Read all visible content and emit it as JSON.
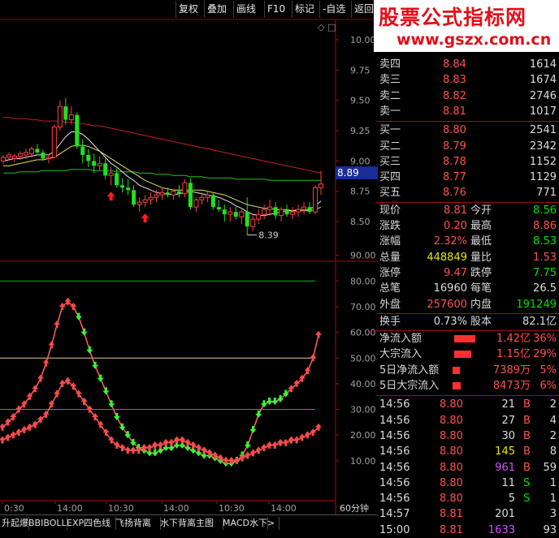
{
  "toolbar": {
    "buttons": [
      {
        "name": "fuquan-button",
        "label": "复权"
      },
      {
        "name": "diejia-button",
        "label": "叠加"
      },
      {
        "name": "huaxian-button",
        "label": "画线"
      },
      {
        "name": "f10-button",
        "label": "F10"
      },
      {
        "name": "biaoji-button",
        "label": "标记"
      },
      {
        "name": "zixuan-button",
        "label": "-自选"
      },
      {
        "name": "fanhui-button",
        "label": "返回"
      }
    ]
  },
  "watermark": {
    "title": "股票公式指标网",
    "url": "www.gszx.com.cn"
  },
  "price_axis": {
    "ticks": [
      "10.00",
      "9.75",
      "9.50",
      "9.25",
      "9.00",
      "8.75",
      "8.50"
    ],
    "current": "8.89"
  },
  "indicator_axis": {
    "ticks": [
      "90.00",
      "80.00",
      "70.00",
      "60.00",
      "50.00",
      "40.00",
      "30.00",
      "20.00",
      "10.00"
    ]
  },
  "time_axis": {
    "labels": [
      "0:30",
      "14:00",
      "10:30",
      "14:00",
      "10:30",
      "14:00"
    ],
    "period": "60分钟"
  },
  "chart_annotations": {
    "low_label": "8.39"
  },
  "chart_data": [
    {
      "type": "candlestick",
      "title": "",
      "ylim": [
        8.32,
        10.1
      ],
      "candles": [
        [
          9.0,
          9.05,
          8.98,
          9.03
        ],
        [
          9.03,
          9.07,
          9.0,
          9.05
        ],
        [
          9.02,
          9.06,
          8.99,
          9.04
        ],
        [
          9.04,
          9.08,
          9.01,
          9.06
        ],
        [
          9.05,
          9.1,
          9.02,
          9.07
        ],
        [
          9.06,
          9.12,
          9.03,
          9.1
        ],
        [
          9.1,
          9.14,
          9.06,
          9.07
        ],
        [
          9.07,
          9.09,
          9.0,
          9.02
        ],
        [
          9.02,
          9.06,
          8.98,
          9.03
        ],
        [
          9.03,
          9.3,
          9.02,
          9.28
        ],
        [
          9.28,
          9.5,
          9.25,
          9.45
        ],
        [
          9.45,
          9.52,
          9.3,
          9.34
        ],
        [
          9.34,
          9.45,
          9.3,
          9.38
        ],
        [
          9.38,
          9.4,
          9.1,
          9.12
        ],
        [
          9.12,
          9.18,
          8.98,
          9.05
        ],
        [
          9.05,
          9.1,
          8.95,
          9.0
        ],
        [
          9.0,
          9.06,
          8.9,
          8.96
        ],
        [
          8.96,
          9.04,
          8.92,
          8.98
        ],
        [
          8.98,
          9.02,
          8.85,
          8.88
        ],
        [
          8.88,
          8.95,
          8.8,
          8.9
        ],
        [
          8.9,
          8.94,
          8.78,
          8.8
        ],
        [
          8.8,
          8.86,
          8.74,
          8.78
        ],
        [
          8.78,
          8.85,
          8.72,
          8.76
        ],
        [
          8.76,
          8.8,
          8.62,
          8.64
        ],
        [
          8.64,
          8.7,
          8.58,
          8.66
        ],
        [
          8.66,
          8.72,
          8.62,
          8.68
        ],
        [
          8.68,
          8.74,
          8.64,
          8.7
        ],
        [
          8.7,
          8.76,
          8.66,
          8.72
        ],
        [
          8.72,
          8.78,
          8.68,
          8.74
        ],
        [
          8.74,
          8.78,
          8.7,
          8.72
        ],
        [
          8.72,
          8.77,
          8.68,
          8.75
        ],
        [
          8.75,
          8.8,
          8.7,
          8.73
        ],
        [
          8.73,
          8.85,
          8.7,
          8.82
        ],
        [
          8.82,
          8.86,
          8.6,
          8.62
        ],
        [
          8.62,
          8.7,
          8.58,
          8.68
        ],
        [
          8.68,
          8.74,
          8.64,
          8.7
        ],
        [
          8.7,
          8.75,
          8.66,
          8.72
        ],
        [
          8.72,
          8.74,
          8.6,
          8.62
        ],
        [
          8.62,
          8.68,
          8.58,
          8.6
        ],
        [
          8.6,
          8.64,
          8.5,
          8.56
        ],
        [
          8.56,
          8.62,
          8.5,
          8.58
        ],
        [
          8.58,
          8.62,
          8.52,
          8.54
        ],
        [
          8.54,
          8.6,
          8.48,
          8.58
        ],
        [
          8.58,
          8.7,
          8.39,
          8.46
        ],
        [
          8.46,
          8.56,
          8.42,
          8.52
        ],
        [
          8.52,
          8.6,
          8.48,
          8.56
        ],
        [
          8.56,
          8.64,
          8.52,
          8.6
        ],
        [
          8.6,
          8.68,
          8.55,
          8.62
        ],
        [
          8.62,
          8.66,
          8.52,
          8.55
        ],
        [
          8.55,
          8.62,
          8.5,
          8.6
        ],
        [
          8.6,
          8.64,
          8.54,
          8.56
        ],
        [
          8.56,
          8.62,
          8.52,
          8.58
        ],
        [
          8.58,
          8.64,
          8.54,
          8.6
        ],
        [
          8.6,
          8.66,
          8.56,
          8.62
        ],
        [
          8.62,
          8.66,
          8.56,
          8.58
        ],
        [
          8.58,
          8.8,
          8.56,
          8.78
        ],
        [
          8.78,
          8.92,
          8.72,
          8.81
        ]
      ],
      "series": [
        {
          "values": [
            9.36,
            9.36,
            9.35,
            9.35,
            9.35,
            9.34,
            9.34,
            9.33,
            9.33,
            9.33,
            9.33,
            9.32,
            9.32,
            9.31,
            9.31,
            9.3,
            9.29,
            9.29,
            9.28,
            9.27,
            9.26,
            9.25,
            9.24,
            9.23,
            9.22,
            9.21,
            9.2,
            9.19,
            9.18,
            9.17,
            9.16,
            9.15,
            9.14,
            9.13,
            9.12,
            9.11,
            9.1,
            9.09,
            9.08,
            9.07,
            9.06,
            9.05,
            9.04,
            9.03,
            9.02,
            9.01,
            9.0,
            8.99,
            8.98,
            8.97,
            8.96,
            8.95,
            8.94,
            8.93,
            8.92,
            8.91,
            8.9
          ],
          "color": "#c02020"
        },
        {
          "values": [
            8.9,
            8.9,
            8.9,
            8.91,
            8.91,
            8.91,
            8.91,
            8.92,
            8.92,
            8.92,
            8.92,
            8.92,
            8.93,
            8.93,
            8.93,
            8.93,
            8.92,
            8.92,
            8.92,
            8.92,
            8.91,
            8.91,
            8.91,
            8.91,
            8.9,
            8.9,
            8.9,
            8.89,
            8.89,
            8.89,
            8.88,
            8.88,
            8.88,
            8.87,
            8.87,
            8.87,
            8.86,
            8.86,
            8.86,
            8.86,
            8.86,
            8.85,
            8.85,
            8.85,
            8.85,
            8.85,
            8.85,
            8.84,
            8.84,
            8.84,
            8.84,
            8.84,
            8.84,
            8.84,
            8.84,
            8.84,
            8.84
          ],
          "color": "#20c020"
        },
        {
          "values": [
            9.0,
            9.01,
            9.02,
            9.02,
            9.03,
            9.04,
            9.05,
            9.05,
            9.05,
            9.08,
            9.14,
            9.2,
            9.24,
            9.24,
            9.22,
            9.18,
            9.13,
            9.08,
            9.03,
            8.98,
            8.95,
            8.91,
            8.87,
            8.84,
            8.8,
            8.78,
            8.76,
            8.74,
            8.73,
            8.73,
            8.72,
            8.73,
            8.74,
            8.75,
            8.74,
            8.73,
            8.72,
            8.71,
            8.7,
            8.68,
            8.66,
            8.63,
            8.61,
            8.58,
            8.56,
            8.55,
            8.55,
            8.56,
            8.57,
            8.58,
            8.59,
            8.59,
            8.6,
            8.6,
            8.6,
            8.63,
            8.67
          ],
          "color": "#e8e8e8"
        },
        {
          "values": [
            8.96,
            8.96,
            8.97,
            8.98,
            8.99,
            9.0,
            9.01,
            9.01,
            9.02,
            9.03,
            9.06,
            9.09,
            9.12,
            9.13,
            9.13,
            9.12,
            9.1,
            9.08,
            9.05,
            9.02,
            8.99,
            8.96,
            8.93,
            8.9,
            8.87,
            8.84,
            8.82,
            8.8,
            8.78,
            8.77,
            8.76,
            8.76,
            8.76,
            8.76,
            8.76,
            8.76,
            8.75,
            8.74,
            8.73,
            8.72,
            8.7,
            8.68,
            8.66,
            8.64,
            8.63,
            8.62,
            8.61,
            8.61,
            8.6,
            8.6,
            8.6,
            8.59,
            8.59,
            8.59,
            8.59,
            8.6,
            8.62
          ],
          "color": "#e0e060"
        }
      ],
      "signal_arrows_up": [
        19,
        25
      ]
    },
    {
      "type": "line",
      "title": "",
      "ylim": [
        0,
        100
      ],
      "hlines": [
        {
          "value": 80,
          "color": "#20b020"
        },
        {
          "value": 50,
          "color": "#e8c890"
        },
        {
          "value": 30,
          "color": "#c040c0"
        }
      ],
      "series": [
        {
          "values": [
            23,
            25,
            27,
            30,
            32,
            35,
            38,
            42,
            48,
            55,
            63,
            70,
            72,
            70,
            66,
            60,
            53,
            47,
            42,
            37,
            32,
            27,
            23,
            20,
            17,
            15,
            14,
            13,
            13,
            14,
            15,
            15,
            16,
            16,
            15,
            14,
            13,
            12,
            12,
            11,
            10,
            9,
            9,
            10,
            12,
            16,
            22,
            28,
            32,
            33,
            33,
            34,
            36,
            38,
            40,
            42,
            45,
            50,
            59
          ],
          "color": "#ff6060"
        },
        {
          "values": [
            18,
            19,
            20,
            21,
            22,
            23,
            24,
            26,
            28,
            32,
            36,
            40,
            41,
            39,
            36,
            33,
            30,
            27,
            24,
            21,
            18,
            16,
            15,
            14,
            14,
            14,
            15,
            15,
            16,
            16,
            17,
            17,
            18,
            18,
            17,
            16,
            15,
            14,
            13,
            12,
            11,
            10,
            10,
            10,
            11,
            12,
            13,
            14,
            15,
            16,
            16,
            17,
            17,
            18,
            18,
            19,
            20,
            21,
            23
          ],
          "color": "#ff6060"
        }
      ],
      "green_from_index": 14,
      "green_to_index": 52
    }
  ],
  "quote": {
    "asks": [
      {
        "label": "卖四",
        "price": "8.84",
        "vol": "1614"
      },
      {
        "label": "卖三",
        "price": "8.83",
        "vol": "1674"
      },
      {
        "label": "卖二",
        "price": "8.82",
        "vol": "2746"
      },
      {
        "label": "卖一",
        "price": "8.81",
        "vol": "1017"
      }
    ],
    "bids": [
      {
        "label": "买一",
        "price": "8.80",
        "vol": "2541"
      },
      {
        "label": "买二",
        "price": "8.79",
        "vol": "2342"
      },
      {
        "label": "买三",
        "price": "8.78",
        "vol": "1152"
      },
      {
        "label": "买四",
        "price": "8.77",
        "vol": "1129"
      },
      {
        "label": "买五",
        "price": "8.76",
        "vol": "771"
      }
    ],
    "stats": [
      {
        "l1": "现价",
        "v1": "8.81",
        "c1": "red",
        "l2": "今开",
        "v2": "8.56",
        "c2": "green"
      },
      {
        "l1": "涨跌",
        "v1": "0.20",
        "c1": "red",
        "l2": "最高",
        "v2": "8.86",
        "c2": "red"
      },
      {
        "l1": "涨幅",
        "v1": "2.32%",
        "c1": "red",
        "l2": "最低",
        "v2": "8.53",
        "c2": "green"
      },
      {
        "l1": "总量",
        "v1": "448849",
        "c1": "yellow",
        "l2": "量比",
        "v2": "1.53",
        "c2": "red"
      },
      {
        "l1": "涨停",
        "v1": "9.47",
        "c1": "red",
        "l2": "跌停",
        "v2": "7.75",
        "c2": "green"
      },
      {
        "l1": "总笔",
        "v1": "16960",
        "c1": "white",
        "l2": "每笔",
        "v2": "26.5",
        "c2": "white"
      },
      {
        "l1": "外盘",
        "v1": "257600",
        "c1": "red",
        "l2": "内盘",
        "v2": "191249",
        "c2": "green"
      }
    ],
    "turnover": {
      "label": "换手",
      "value": "0.73%",
      "label2": "股本",
      "value2": "82.1亿"
    },
    "flows": [
      {
        "label": "净流入额",
        "value": "1.42亿",
        "pct": "36%",
        "bar": 36
      },
      {
        "label": "大宗流入",
        "value": "1.15亿",
        "pct": "29%",
        "bar": 29
      },
      {
        "label": "5日净流入额",
        "value": "7389万",
        "pct": "5%",
        "bar": 12
      },
      {
        "label": "5日大宗流入",
        "value": "8473万",
        "pct": "6%",
        "bar": 14
      }
    ],
    "ticks": [
      {
        "time": "14:56",
        "price": "8.80",
        "pc": "red",
        "vol": "21",
        "vc": "white",
        "side": "B",
        "sc": "red",
        "n": "2"
      },
      {
        "time": "14:56",
        "price": "8.80",
        "pc": "red",
        "vol": "27",
        "vc": "white",
        "side": "B",
        "sc": "red",
        "n": "4"
      },
      {
        "time": "14:56",
        "price": "8.80",
        "pc": "red",
        "vol": "30",
        "vc": "white",
        "side": "B",
        "sc": "red",
        "n": "2"
      },
      {
        "time": "14:56",
        "price": "8.80",
        "pc": "red",
        "vol": "145",
        "vc": "yellow",
        "side": "B",
        "sc": "red",
        "n": "8"
      },
      {
        "time": "14:56",
        "price": "8.80",
        "pc": "red",
        "vol": "961",
        "vc": "purple",
        "side": "B",
        "sc": "red",
        "n": "59"
      },
      {
        "time": "14:56",
        "price": "8.80",
        "pc": "red",
        "vol": "11",
        "vc": "white",
        "side": "S",
        "sc": "green",
        "n": "1"
      },
      {
        "time": "14:56",
        "price": "8.80",
        "pc": "red",
        "vol": "5",
        "vc": "white",
        "side": "S",
        "sc": "green",
        "n": "1"
      },
      {
        "time": "14:57",
        "price": "8.81",
        "pc": "red",
        "vol": "201",
        "vc": "white",
        "side": "",
        "sc": "red",
        "n": "3"
      },
      {
        "time": "15:00",
        "price": "8.81",
        "pc": "red",
        "vol": "1633",
        "vc": "purple",
        "side": "",
        "sc": "red",
        "n": "93"
      }
    ]
  },
  "tabs": [
    "升起爆",
    "BBIBOLL",
    "EXP四色线",
    "飞扬背离",
    "水下背离主图",
    "MACD水下",
    ">"
  ]
}
